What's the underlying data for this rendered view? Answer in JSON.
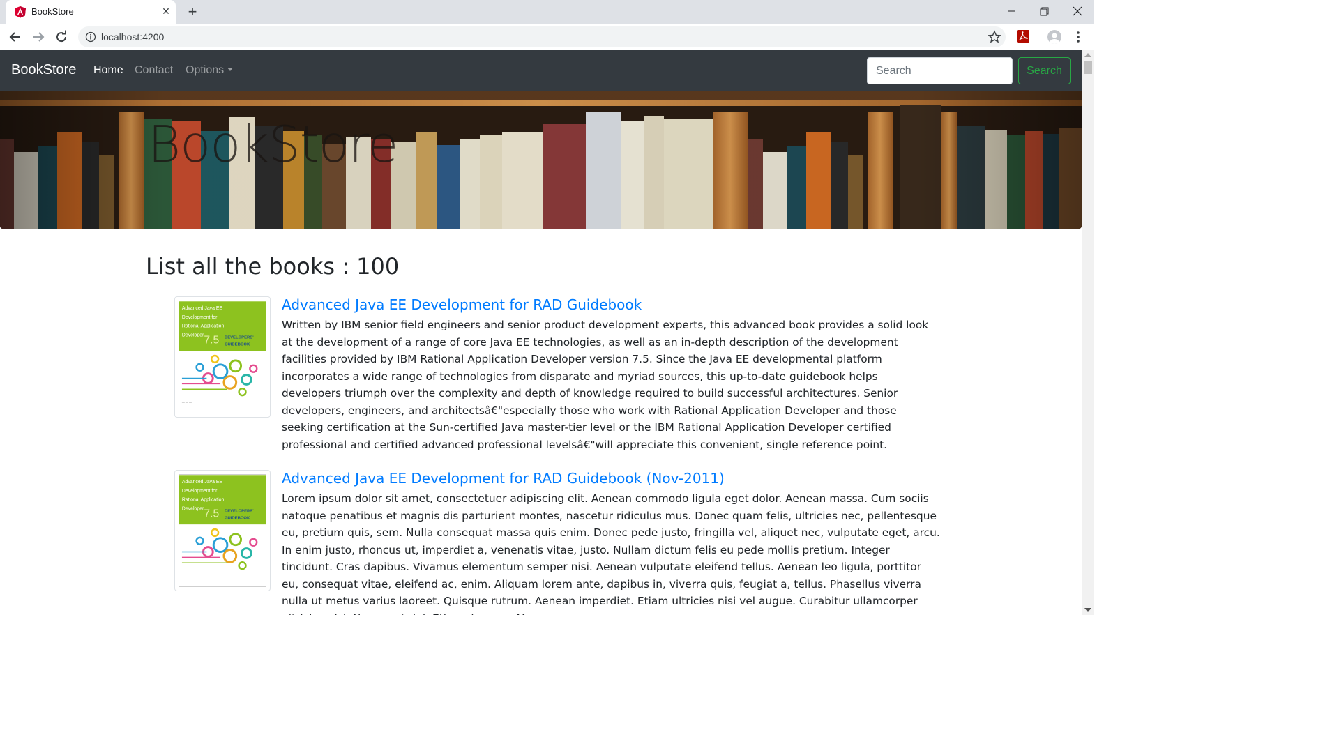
{
  "browser": {
    "tab_title": "BookStore",
    "address": "localhost:4200"
  },
  "navbar": {
    "brand": "BookStore",
    "links": [
      {
        "label": "Home",
        "active": true
      },
      {
        "label": "Contact",
        "active": false
      },
      {
        "label": "Options",
        "active": false,
        "dropdown": true
      }
    ],
    "search_placeholder": "Search",
    "search_button": "Search"
  },
  "hero": {
    "title": "BookStore"
  },
  "list": {
    "heading": "List all the books : 100",
    "books": [
      {
        "title": "Advanced Java EE Development for RAD Guidebook",
        "description": "Written by IBM senior field engineers and senior product development experts, this advanced book provides a solid look at the development of a range of core Java EE technologies, as well as an in-depth description of the development facilities provided by IBM Rational Application Developer version 7.5. Since the Java EE developmental platform incorporates a wide range of technologies from disparate and myriad sources, this up-to-date guidebook helps developers triumph over the complexity and depth of knowledge required to build successful architectures. Senior developers, engineers, and architectsâ€\"especially those who work with Rational Application Developer and those seeking certification at the Sun-certified Java master-tier level or the IBM Rational Application Developer certified professional and certified advanced professional levelsâ€\"will appreciate this convenient, single reference point."
      },
      {
        "title": "Advanced Java EE Development for RAD Guidebook (Nov-2011)",
        "description": "Lorem ipsum dolor sit amet, consectetuer adipiscing elit. Aenean commodo ligula eget dolor. Aenean massa. Cum sociis natoque penatibus et magnis dis parturient montes, nascetur ridiculus mus. Donec quam felis, ultricies nec, pellentesque eu, pretium quis, sem. Nulla consequat massa quis enim. Donec pede justo, fringilla vel, aliquet nec, vulputate eget, arcu. In enim justo, rhoncus ut, imperdiet a, venenatis vitae, justo. Nullam dictum felis eu pede mollis pretium. Integer tincidunt. Cras dapibus. Vivamus elementum semper nisi. Aenean vulputate eleifend tellus. Aenean leo ligula, porttitor eu, consequat vitae, eleifend ac, enim. Aliquam lorem ante, dapibus in, viverra quis, feugiat a, tellus. Phasellus viverra nulla ut metus varius laoreet. Quisque rutrum. Aenean imperdiet. Etiam ultricies nisi vel augue. Curabitur ullamcorper ultricies nisi. Nam eget dui. Etiam rhoncus. Maecenas"
      }
    ]
  },
  "cover": {
    "line1": "Advanced Java EE",
    "line2": "Development for",
    "line3": "Rational Application",
    "line4": "Developer",
    "version": "7.5",
    "badge1": "DEVELOPERS'",
    "badge2": "GUIDEBOOK"
  },
  "colors": {
    "navbar_bg": "#343a40",
    "link": "#007bff",
    "search_btn": "#28a745",
    "cover_green": "#8dc21f"
  }
}
